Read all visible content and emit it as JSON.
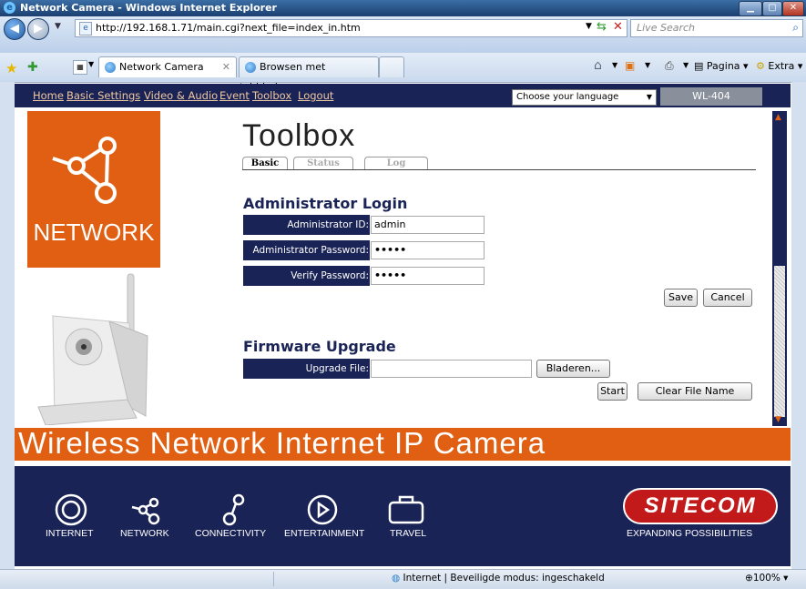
{
  "window": {
    "title": "Network Camera - Windows Internet Explorer"
  },
  "address_bar": {
    "url": "http://192.168.1.71/main.cgi?next_file=index_in.htm",
    "search_placeholder": "Live Search"
  },
  "tabs": [
    {
      "label": "Network Camera",
      "active": true
    },
    {
      "label": "Browsen met tabbladen",
      "active": false
    }
  ],
  "toolbar": {
    "page_label": "Pagina",
    "extra_label": "Extra"
  },
  "camera_nav": {
    "links": [
      "Home",
      "Basic Settings",
      "Video & Audio",
      "Event",
      "Toolbox",
      "Logout"
    ],
    "language_select": "Choose your language",
    "model": "WL-404"
  },
  "logo": {
    "network_text": "NETWORK"
  },
  "page": {
    "title": "Toolbox",
    "subtabs": [
      "Basic",
      "Status",
      "Log"
    ],
    "admin_section": {
      "title": "Administrator Login",
      "id_label": "Administrator ID:",
      "id_value": "admin",
      "password_label": "Administrator Password:",
      "password_value": "•••••",
      "verify_label": "Verify Password:",
      "verify_value": "•••••",
      "save_label": "Save",
      "cancel_label": "Cancel"
    },
    "firmware_section": {
      "title": "Firmware Upgrade",
      "file_label": "Upgrade File:",
      "file_value": "",
      "browse_label": "Bladeren...",
      "start_label": "Start",
      "clear_label": "Clear File Name"
    }
  },
  "banner": {
    "tagline": "Wireless Network Internet IP Camera"
  },
  "footer": {
    "categories": [
      "INTERNET",
      "NETWORK",
      "CONNECTIVITY",
      "ENTERTAINMENT",
      "TRAVEL"
    ],
    "brand": "SITECOM",
    "slogan": "EXPANDING POSSIBILITIES"
  },
  "statusbar": {
    "zone": "Internet | Beveiligde modus: ingeschakeld",
    "zoom": "100%"
  },
  "colors": {
    "navy": "#1a2356",
    "orange": "#e05f12"
  }
}
